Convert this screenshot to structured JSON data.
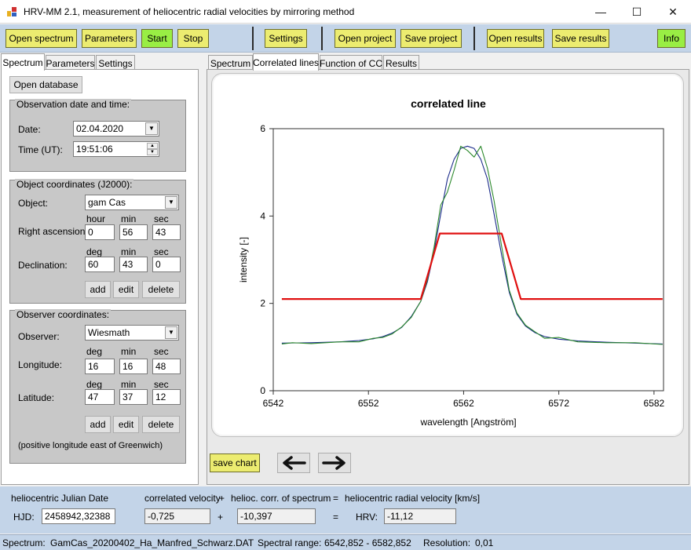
{
  "window": {
    "title": "HRV-MM 2.1,   measurement of heliocentric radial velocities by mirroring method",
    "min_glyph": "—",
    "max_glyph": "☐",
    "close_glyph": "✕"
  },
  "toolbar": {
    "open_spectrum": "Open spectrum",
    "parameters": "Parameters",
    "start": "Start",
    "stop": "Stop",
    "settings": "Settings",
    "open_project": "Open project",
    "save_project": "Save project",
    "open_results": "Open results",
    "save_results": "Save results",
    "info": "Info"
  },
  "left_tabs": [
    "Spectrum",
    "Parameters",
    "Settings"
  ],
  "right_tabs": [
    "Spectrum",
    "Correlated lines",
    "Function of CC",
    "Results"
  ],
  "left": {
    "open_database": "Open database",
    "observation": {
      "title": "Observation date and time:",
      "date_label": "Date:",
      "date_value": "02.04.2020",
      "time_label": "Time (UT):",
      "time_value": "19:51:06"
    },
    "object": {
      "title": "Object coordinates (J2000):",
      "object_label": "Object:",
      "object_value": "gam Cas",
      "hour": "hour",
      "min": "min",
      "sec": "sec",
      "deg": "deg",
      "ra_label": "Right ascension:",
      "ra_h": "0",
      "ra_m": "56",
      "ra_s": "43",
      "dec_label": "Declination:",
      "dec_d": "60",
      "dec_m": "43",
      "dec_s": "0",
      "add": "add",
      "edit": "edit",
      "delete": "delete"
    },
    "observer": {
      "title": "Observer coordinates:",
      "observer_label": "Observer:",
      "observer_value": "Wiesmath",
      "deg": "deg",
      "min": "min",
      "sec": "sec",
      "lon_label": "Longitude:",
      "lon_d": "16",
      "lon_m": "16",
      "lon_s": "48",
      "lat_label": "Latitude:",
      "lat_d": "47",
      "lat_m": "37",
      "lat_s": "12",
      "add": "add",
      "edit": "edit",
      "delete": "delete",
      "note": "(positive longitude east of Greenwich)"
    }
  },
  "right": {
    "save_chart": "save chart",
    "prev_icon": "left-arrow-icon",
    "next_icon": "right-arrow-icon"
  },
  "bottom": {
    "hjd_header": "heliocentric Julian Date",
    "corr_header": "correlated velocity",
    "plus1": "+",
    "helio_header": "helioc. corr. of spectrum",
    "eq1": "=",
    "hrv_header": "heliocentric radial velocity [km/s]",
    "hjd_label": "HJD:",
    "hjd_value": "2458942,32388",
    "corr_value": "-0,725",
    "plus2": "+",
    "helio_value": "-10,397",
    "eq2": "=",
    "hrv_label": "HRV:",
    "hrv_value": "-11,12"
  },
  "status": {
    "spectrum_label": "Spectrum:",
    "spectrum_value": "GamCas_20200402_Ha_Manfred_Schwarz.DAT",
    "range_label": "Spectral range:",
    "range_value": "6542,852 - 6582,852",
    "res_label": "Resolution:",
    "res_value": "0,01"
  },
  "colors": {
    "toolbar_bg": "#c3d4e8",
    "yellow_btn": "#ecec70",
    "green_btn": "#99ee44",
    "mirror_line": "#e01010",
    "series_blue": "#1a2a8a",
    "series_green": "#2e8a2e"
  },
  "chart_data": {
    "type": "line",
    "title": "correlated line",
    "xlabel": "wavelength [Angström]",
    "ylabel": "intensity [-]",
    "xlim": [
      6542,
      6583
    ],
    "ylim": [
      0,
      6
    ],
    "xticks": [
      6542,
      6552,
      6562,
      6572,
      6582
    ],
    "yticks": [
      0,
      2,
      4,
      6
    ],
    "grid": false,
    "legend": "none",
    "series": [
      {
        "color": "#1a2a8a",
        "x": [
          6542.9,
          6546,
          6549,
          6551,
          6552.5,
          6553.5,
          6554.5,
          6555.5,
          6556.5,
          6557.5,
          6558.2,
          6558.9,
          6559.6,
          6560.3,
          6561,
          6561.7,
          6562.4,
          6563.1,
          6563.8,
          6564.5,
          6565.2,
          6566,
          6566.8,
          6567.6,
          6568.5,
          6569.5,
          6570.5,
          6572,
          6574,
          6577,
          6580,
          6582.9
        ],
        "y": [
          1.09,
          1.1,
          1.12,
          1.15,
          1.19,
          1.24,
          1.32,
          1.45,
          1.7,
          2.05,
          2.5,
          3.2,
          4.05,
          4.85,
          5.3,
          5.55,
          5.6,
          5.55,
          5.3,
          4.85,
          4.05,
          3.1,
          2.25,
          1.75,
          1.48,
          1.33,
          1.24,
          1.18,
          1.14,
          1.11,
          1.09,
          1.07
        ]
      },
      {
        "color": "#2e8a2e",
        "x": [
          6542.9,
          6544,
          6546,
          6549,
          6551,
          6552.5,
          6553.5,
          6554.5,
          6555.5,
          6556.5,
          6557.5,
          6558.2,
          6558.9,
          6559.6,
          6560.3,
          6561,
          6561.7,
          6562.4,
          6563.1,
          6563.8,
          6564.5,
          6565.2,
          6566,
          6566.8,
          6567.6,
          6568.5,
          6569.5,
          6570.5,
          6572,
          6574,
          6577,
          6580,
          6582.9
        ],
        "y": [
          1.07,
          1.1,
          1.08,
          1.12,
          1.12,
          1.2,
          1.22,
          1.3,
          1.46,
          1.68,
          2.05,
          2.55,
          3.3,
          4.25,
          4.55,
          5.05,
          5.6,
          5.5,
          5.35,
          5.6,
          5.1,
          4.35,
          3.3,
          2.3,
          1.78,
          1.5,
          1.35,
          1.2,
          1.22,
          1.12,
          1.1,
          1.1,
          1.06
        ]
      },
      {
        "color": "#e01010",
        "x": [
          6542.9,
          6557.5,
          6559.5,
          6566,
          6568,
          6582.9
        ],
        "y": [
          2.1,
          2.1,
          3.6,
          3.6,
          2.1,
          2.1
        ]
      }
    ]
  }
}
